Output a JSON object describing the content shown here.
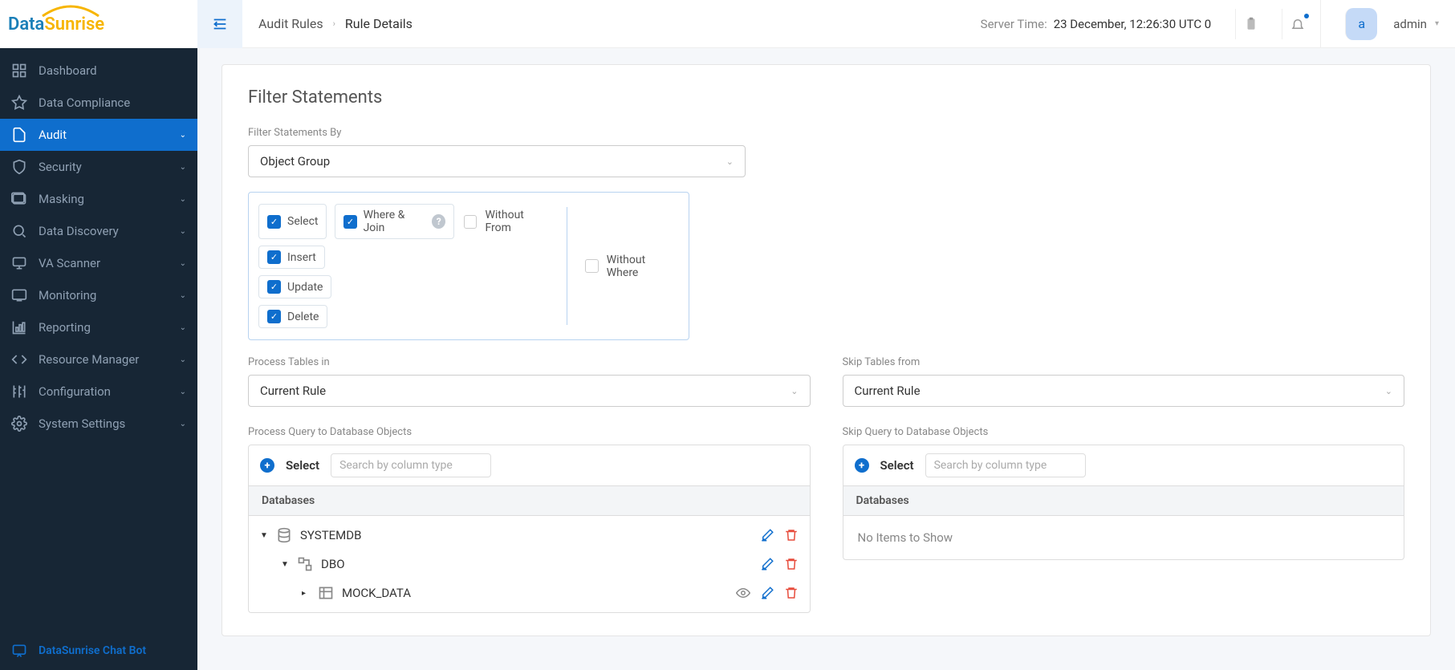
{
  "logo": {
    "part1": "Data",
    "part2": "Sunrise"
  },
  "breadcrumb": {
    "root": "Audit Rules",
    "current": "Rule Details"
  },
  "server_time": {
    "label": "Server Time:",
    "value": "23 December, 12:26:30  UTC 0"
  },
  "user": {
    "initial": "a",
    "name": "admin"
  },
  "sidebar": {
    "items": [
      {
        "label": "Dashboard",
        "expandable": false
      },
      {
        "label": "Data Compliance",
        "expandable": false
      },
      {
        "label": "Audit",
        "expandable": true,
        "active": true
      },
      {
        "label": "Security",
        "expandable": true
      },
      {
        "label": "Masking",
        "expandable": true
      },
      {
        "label": "Data Discovery",
        "expandable": true
      },
      {
        "label": "VA Scanner",
        "expandable": true
      },
      {
        "label": "Monitoring",
        "expandable": true
      },
      {
        "label": "Reporting",
        "expandable": true
      },
      {
        "label": "Resource Manager",
        "expandable": true
      },
      {
        "label": "Configuration",
        "expandable": true
      },
      {
        "label": "System Settings",
        "expandable": true
      }
    ],
    "chatbot": "DataSunrise Chat Bot"
  },
  "section": {
    "title": "Filter Statements",
    "filter_by_label": "Filter Statements By",
    "filter_by_value": "Object Group",
    "checks": {
      "select": "Select",
      "where_join": "Where & Join",
      "without_from": "Without From",
      "insert": "Insert",
      "update": "Update",
      "delete": "Delete",
      "without_where": "Without Where"
    },
    "process_tables_label": "Process Tables in",
    "process_tables_value": "Current Rule",
    "skip_tables_label": "Skip Tables from",
    "skip_tables_value": "Current Rule",
    "process_query_label": "Process Query to Database Objects",
    "skip_query_label": "Skip Query to Database Objects",
    "select_btn": "Select",
    "search_placeholder": "Search by column type",
    "databases_header": "Databases",
    "no_items": "No Items to Show",
    "tree": [
      {
        "label": "SYSTEMDB",
        "level": 0,
        "icon": "db",
        "expanded": true,
        "edit": true,
        "del": true
      },
      {
        "label": "DBO",
        "level": 1,
        "icon": "schema",
        "expanded": true,
        "edit": true,
        "del": true
      },
      {
        "label": "MOCK_DATA",
        "level": 2,
        "icon": "table",
        "expanded": false,
        "eye": true,
        "edit": true,
        "del": true
      }
    ]
  }
}
